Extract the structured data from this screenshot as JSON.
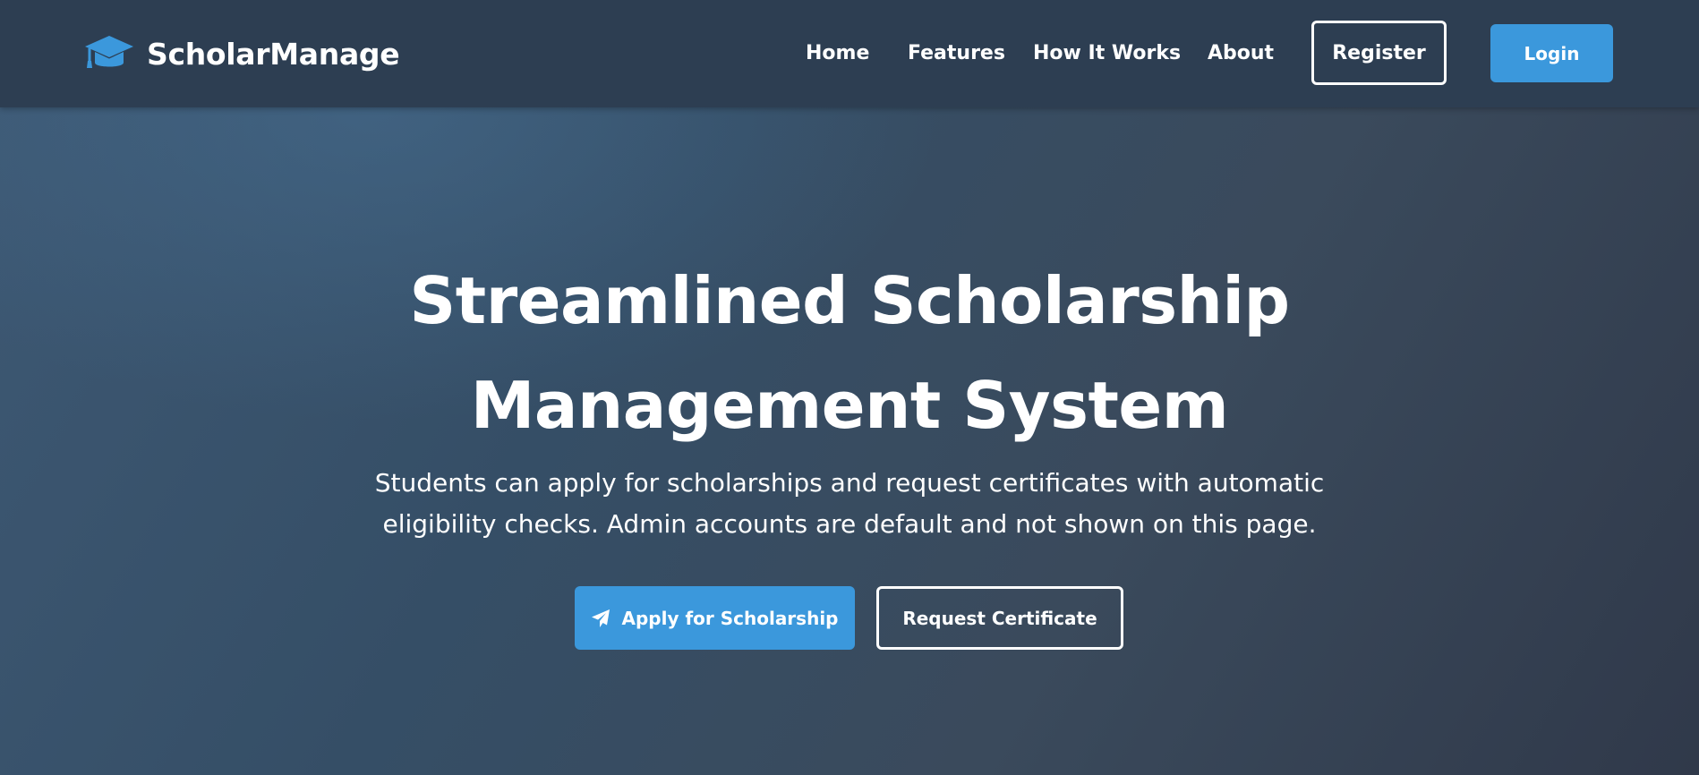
{
  "navbar": {
    "brand": {
      "icon": "graduation-cap-icon",
      "name": "ScholarManage"
    },
    "links": {
      "home": "Home",
      "features": "Features",
      "how_it_works": "How It Works",
      "about": "About"
    },
    "register_label": "Register",
    "login_label": "Login"
  },
  "hero": {
    "title": "Streamlined Scholarship Management System",
    "subtitle": "Students can apply for scholarships and request certificates with automatic eligibility checks. Admin accounts are default and not shown on this page.",
    "apply_button": {
      "icon": "paper-plane-icon",
      "label": "Apply for Scholarship"
    },
    "certificate_button_label": "Request Certificate"
  },
  "colors": {
    "navbar_bg": "#2d3e52",
    "accent_blue": "#3b98dc",
    "hero_gradient_start": "#3d5873",
    "hero_gradient_end": "#30394a",
    "text": "#ffffff"
  }
}
